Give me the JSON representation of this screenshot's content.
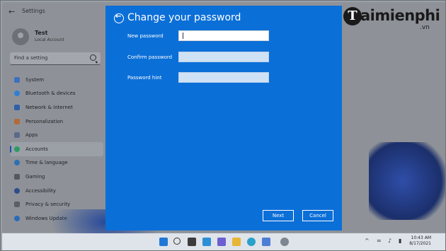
{
  "settings": {
    "title": "Settings",
    "user": {
      "name": "Test",
      "account_type": "Local Account"
    },
    "search_placeholder": "Find a setting",
    "nav": [
      {
        "label": "System",
        "color": "#3f6fbf"
      },
      {
        "label": "Bluetooth & devices",
        "color": "#2e7fd6"
      },
      {
        "label": "Network & internet",
        "color": "#2f5fa8"
      },
      {
        "label": "Personalization",
        "color": "#b36a3a"
      },
      {
        "label": "Apps",
        "color": "#5a6a8a"
      },
      {
        "label": "Accounts",
        "color": "#2c9c62",
        "active": true
      },
      {
        "label": "Time & language",
        "color": "#2d6fb5"
      },
      {
        "label": "Gaming",
        "color": "#55595f"
      },
      {
        "label": "Accessibility",
        "color": "#2c4f8a"
      },
      {
        "label": "Privacy & security",
        "color": "#5a5e66"
      },
      {
        "label": "Windows Update",
        "color": "#2a6ab8"
      }
    ]
  },
  "dialog": {
    "title": "Change your password",
    "fields": {
      "new_password": "New password",
      "confirm_password": "Confirm password",
      "password_hint": "Password hint"
    },
    "next_label": "Next",
    "cancel_label": "Cancel",
    "accent": "#0b6fd8"
  },
  "taskbar": {
    "time": "10:43 AM",
    "date": "8/17/2021",
    "tray_chevron": "^"
  },
  "watermark": {
    "brand": "aimienphi",
    "badge_letter": "T",
    "suffix": ".vn"
  }
}
